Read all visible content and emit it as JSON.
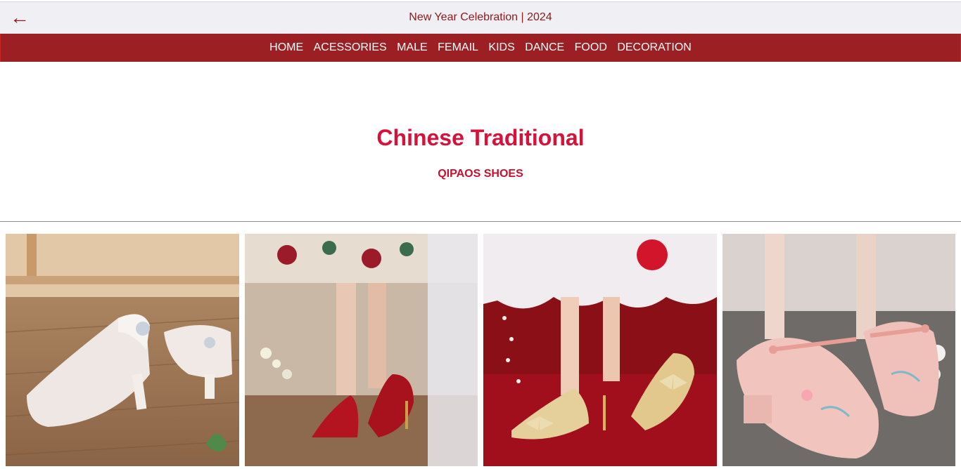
{
  "header": {
    "back_icon": "left-arrow-icon",
    "back_glyph": "←",
    "title": "New Year Celebration | 2024"
  },
  "nav": {
    "items": [
      "HOME",
      "ACESSORIES",
      "MALE",
      "FEMAIL",
      "KIDS",
      "DANCE",
      "FOOD",
      "DECORATION"
    ]
  },
  "hero": {
    "title": "Chinese Traditional",
    "subtitle": "QIPAOS SHOES"
  },
  "gallery": {
    "images": [
      "white-lace-kitten-heel-shoes-image",
      "red-suede-pump-shoes-image",
      "gold-glitter-bow-heels-image",
      "pink-embroidered-mary-jane-shoes-image"
    ]
  },
  "colors": {
    "accent": "#9c2023",
    "title_red": "#d4123a",
    "header_bg": "#f0eff4"
  }
}
